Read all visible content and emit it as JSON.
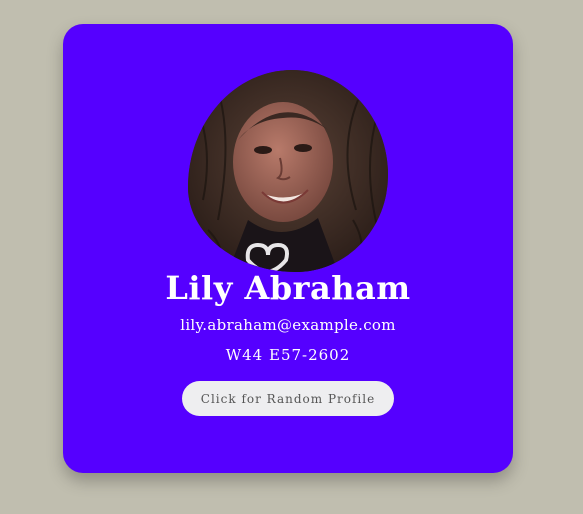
{
  "profile": {
    "name": "Lily Abraham",
    "email": "lily.abraham@example.com",
    "phone": "W44 E57-2602",
    "avatar": "profile-photo"
  },
  "actions": {
    "random_label": "Click for Random Profile"
  },
  "colors": {
    "page_background": "#c0beaf",
    "card_background": "#5500ff",
    "text": "#ffffff",
    "button_background": "#eeeef0"
  }
}
